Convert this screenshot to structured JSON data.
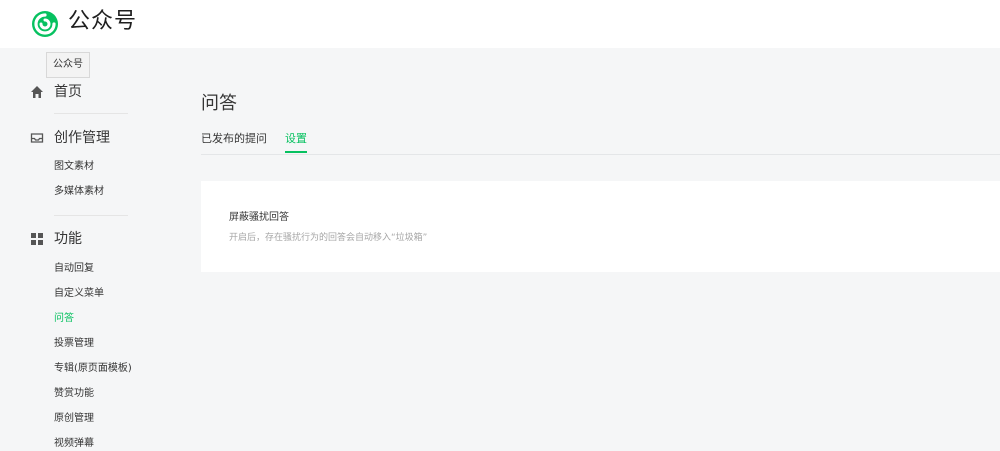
{
  "app": {
    "title": "公众号"
  },
  "tooltip": {
    "text": "公众号"
  },
  "sidebar": {
    "home": {
      "label": "首页",
      "icon": "home-icon"
    },
    "creation": {
      "label": "创作管理",
      "icon": "inbox-icon",
      "items": [
        {
          "label": "图文素材"
        },
        {
          "label": "多媒体素材"
        }
      ]
    },
    "features": {
      "label": "功能",
      "icon": "grid-icon",
      "items": [
        {
          "label": "自动回复"
        },
        {
          "label": "自定义菜单"
        },
        {
          "label": "问答",
          "active": true
        },
        {
          "label": "投票管理"
        },
        {
          "label": "专辑(原页面模板)"
        },
        {
          "label": "赞赏功能"
        },
        {
          "label": "原创管理"
        },
        {
          "label": "视频弹幕"
        }
      ]
    }
  },
  "main": {
    "title": "问答",
    "tabs": [
      {
        "label": "已发布的提问"
      },
      {
        "label": "设置",
        "active": true
      }
    ],
    "card": {
      "title": "屏蔽骚扰回答",
      "description": "开启后，存在骚扰行为的回答会自动移入“垃圾箱”"
    }
  },
  "colors": {
    "accent": "#07c160",
    "background": "#f5f6f7",
    "text": "#353535",
    "muted": "#a6a6a6"
  }
}
